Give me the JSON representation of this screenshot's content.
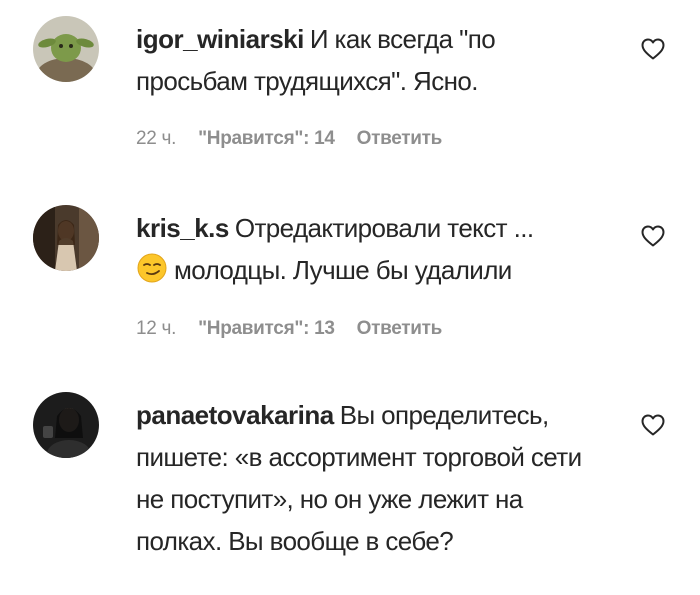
{
  "comments": [
    {
      "username": "igor_winiarski",
      "text": "И как всегда \"по просьбам трудящихся\". Ясно.",
      "emoji": "",
      "time": "22 ч.",
      "likes": "\"Нравится\": 14",
      "reply": "Ответить"
    },
    {
      "username": "kris_k.s",
      "text": "Отредактировали текст ...",
      "emoji": "smirking-face-emoji",
      "text2": "молодцы. Лучше бы удалили",
      "time": "12 ч.",
      "likes": "\"Нравится\": 13",
      "reply": "Ответить"
    },
    {
      "username": "panaetovakarina",
      "text": "Вы определитесь, пишете: «в ассортимент торговой сети не поступит», но он уже лежит на полках. Вы вообще в себе?",
      "emoji": ""
    }
  ],
  "colors": {
    "text": "#262626",
    "meta": "#8e8e8e",
    "background": "#ffffff"
  },
  "icons": {
    "like": "heart-outline-icon"
  }
}
